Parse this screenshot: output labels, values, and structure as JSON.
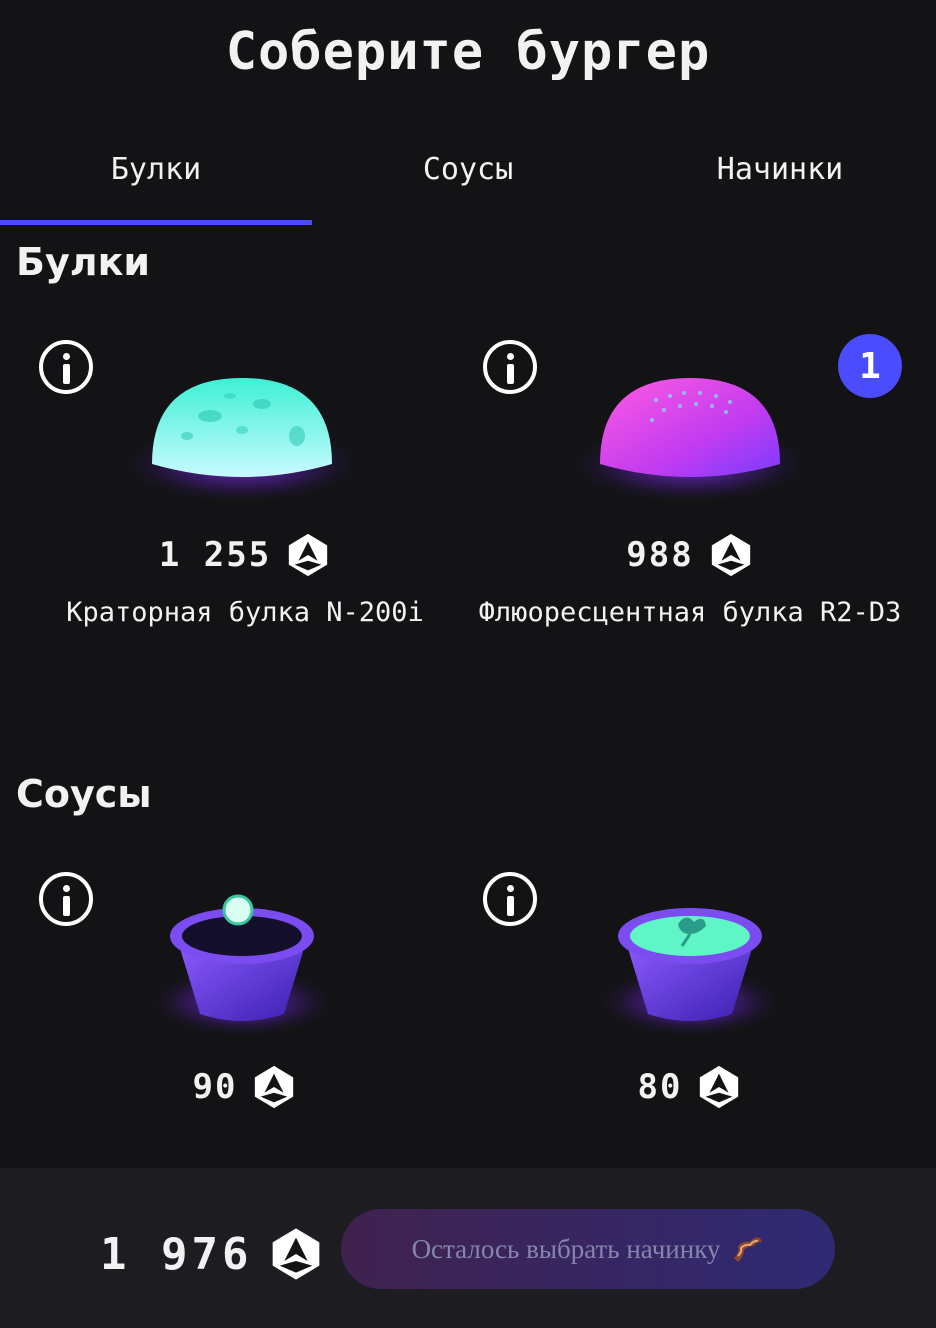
{
  "title": "Соберите бургер",
  "tabs": [
    {
      "label": "Булки",
      "active": true
    },
    {
      "label": "Соусы",
      "active": false
    },
    {
      "label": "Начинки",
      "active": false
    }
  ],
  "sections": {
    "buns": {
      "title": "Булки",
      "items": [
        {
          "name": "Краторная булка N-200i",
          "price": "1 255",
          "count": null
        },
        {
          "name": "Флюоресцентная булка R2-D3",
          "price": "988",
          "count": "1"
        }
      ]
    },
    "sauces": {
      "title": "Соусы",
      "items": [
        {
          "name": "",
          "price": "90"
        },
        {
          "name": "",
          "price": "80"
        }
      ]
    }
  },
  "footer": {
    "total": "1 976",
    "button_label": "Осталось выбрать начинку"
  },
  "icons": {
    "currency": "currency-icon",
    "info": "info-icon",
    "bacon": "bacon-icon"
  },
  "colors": {
    "accent": "#4c4cff",
    "background": "#131316",
    "footer": "#1c1c21"
  }
}
